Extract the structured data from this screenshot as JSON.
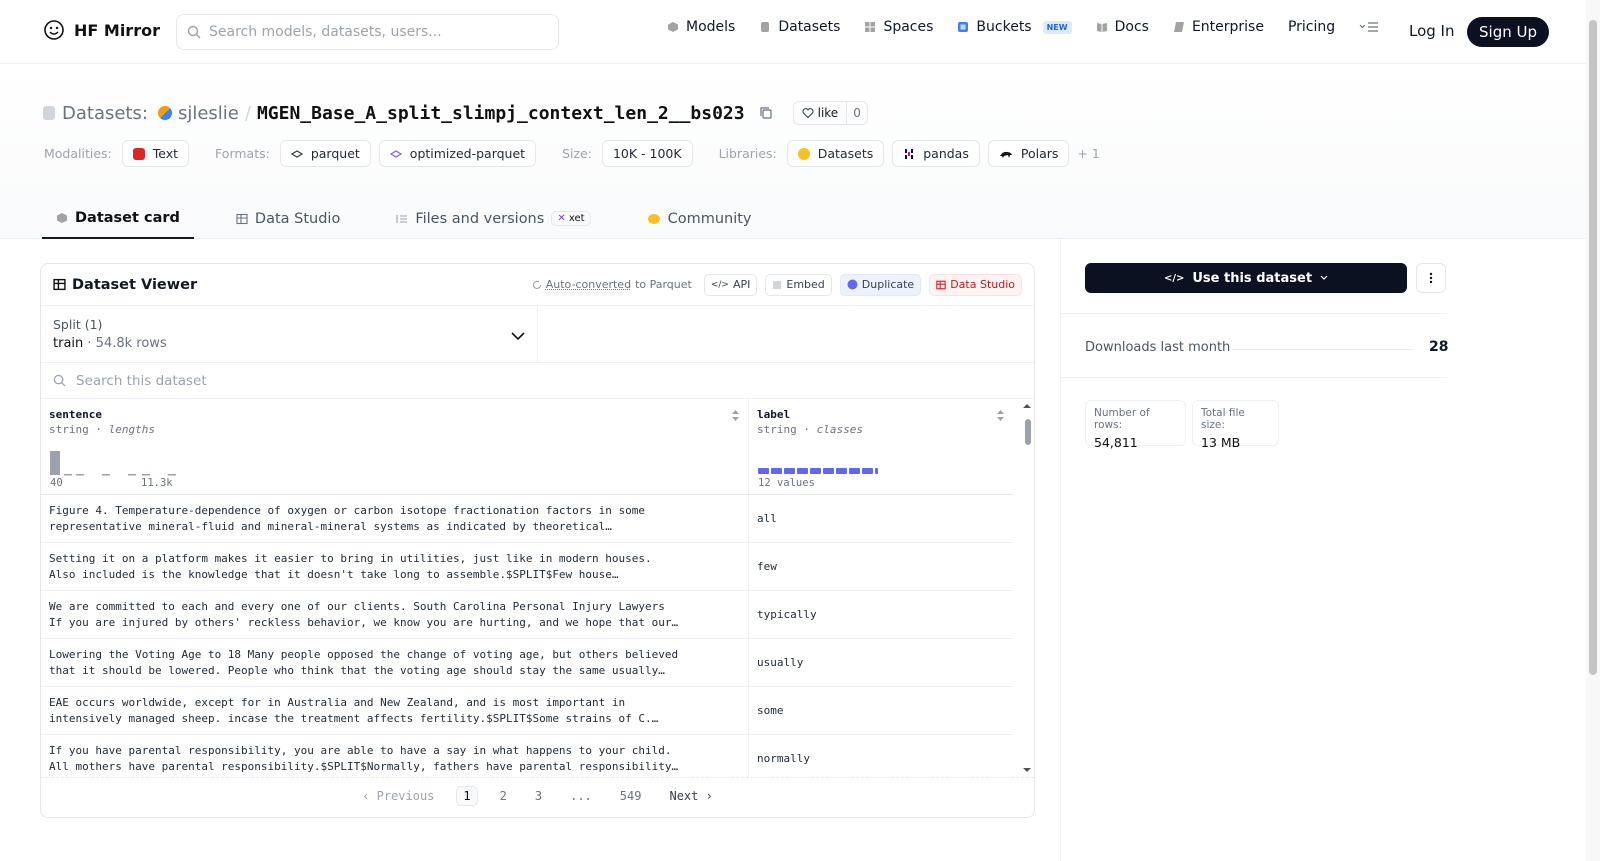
{
  "nav": {
    "brand": "HF Mirror",
    "search_placeholder": "Search models, datasets, users...",
    "items": [
      {
        "label": "Models",
        "icon": "cube-icon",
        "color": "#a3a3a3"
      },
      {
        "label": "Datasets",
        "icon": "database-icon",
        "color": "#a3a3a3"
      },
      {
        "label": "Spaces",
        "icon": "grid-icon",
        "color": "#a3a3a3"
      },
      {
        "label": "Buckets",
        "icon": "bucket-icon",
        "color": "#3b82f6",
        "badge": "NEW"
      },
      {
        "label": "Docs",
        "icon": "book-icon",
        "color": "#a3a3a3"
      },
      {
        "label": "Enterprise",
        "icon": "enterprise-icon",
        "color": "#a3a3a3"
      },
      {
        "label": "Pricing"
      }
    ],
    "login": "Log In",
    "signup": "Sign Up"
  },
  "repo": {
    "type_label": "Datasets:",
    "owner": "sjleslie",
    "name": "MGEN_Base_A_split_slimpj_context_len_2__bs023",
    "like_label": "like",
    "like_count": "0"
  },
  "meta": {
    "modalities_label": "Modalities:",
    "modalities": [
      "Text"
    ],
    "formats_label": "Formats:",
    "formats": [
      "parquet",
      "optimized-parquet"
    ],
    "size_label": "Size:",
    "size": "10K - 100K",
    "libraries_label": "Libraries:",
    "libraries": [
      "Datasets",
      "pandas",
      "Polars"
    ],
    "libraries_more": "+ 1"
  },
  "tabs": [
    {
      "label": "Dataset card",
      "active": true
    },
    {
      "label": "Data Studio"
    },
    {
      "label": "Files and versions",
      "badge": "xet"
    },
    {
      "label": "Community"
    }
  ],
  "viewer": {
    "title": "Dataset Viewer",
    "converted_link": "Auto-converted",
    "converted_suffix": "to Parquet",
    "api": "API",
    "embed": "Embed",
    "duplicate": "Duplicate",
    "data_studio": "Data Studio",
    "split_label": "Split (1)",
    "split_value": "train",
    "split_rows": "54.8k rows",
    "search_placeholder": "Search this dataset",
    "columns": [
      {
        "name": "sentence",
        "type": "string",
        "stat": "lengths",
        "min": "40",
        "max": "11.3k"
      },
      {
        "name": "label",
        "type": "string",
        "stat": "classes",
        "summary": "12 values"
      }
    ],
    "rows": [
      {
        "sentence": [
          "Figure 4. Temperature-dependence of oxygen or carbon isotope fractionation factors in some",
          "representative mineral-fluid and mineral-mineral systems as indicated by theoretical…"
        ],
        "label": "all"
      },
      {
        "sentence": [
          "Setting it on a platform makes it easier to bring in utilities, just like in modern houses.",
          "Also included is the knowledge that it doesn't take long to assemble.$SPLIT$Few house…"
        ],
        "label": "few"
      },
      {
        "sentence": [
          "We are committed to each and every one of our clients. South Carolina Personal Injury Lawyers",
          "If you are injured by others' reckless behavior, we know you are hurting, and we hope that our…"
        ],
        "label": "typically"
      },
      {
        "sentence": [
          "Lowering the Voting Age to 18 Many people opposed the change of voting age, but others believed",
          "that it should be lowered. People who think that the voting age should stay the same usually…"
        ],
        "label": "usually"
      },
      {
        "sentence": [
          "EAE occurs worldwide, except for in Australia and New Zealand, and is most important in",
          "intensively managed sheep. incase the treatment affects fertility.$SPLIT$Some strains of C.…"
        ],
        "label": "some"
      },
      {
        "sentence": [
          "If you have parental responsibility, you are able to have a say in what happens to your child.",
          "All mothers have parental responsibility.$SPLIT$Normally, fathers have parental responsibility…"
        ],
        "label": "normally"
      }
    ],
    "pager": {
      "prev": "Previous",
      "pages": [
        "1",
        "2",
        "3",
        "...",
        "549"
      ],
      "active": "1",
      "next": "Next"
    }
  },
  "sidebar": {
    "use_button": "Use this dataset",
    "downloads_label": "Downloads last month",
    "downloads_value": "28",
    "stats": [
      {
        "label": "Number of rows:",
        "value": "54,811"
      },
      {
        "label": "Total file size:",
        "value": "13 MB"
      }
    ]
  }
}
